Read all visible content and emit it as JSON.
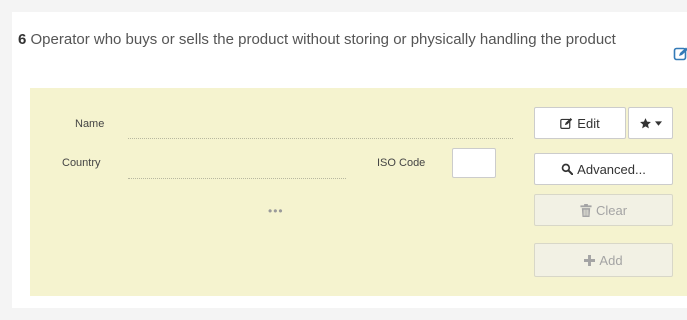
{
  "section": {
    "number": "6",
    "title": "Operator who buys or sells the product without storing or physically handling the product"
  },
  "fields": {
    "name_label": "Name",
    "country_label": "Country",
    "iso_code_label": "ISO Code",
    "more_dots": "•••"
  },
  "buttons": {
    "edit_label": "Edit",
    "advanced_label": "Advanced...",
    "clear_label": "Clear",
    "add_label": "Add"
  },
  "icons": {
    "section_edit": "edit-icon",
    "edit": "pencil-square-icon",
    "favorites": "star-icon",
    "dropdown": "caret-down-icon",
    "advanced": "search-icon",
    "clear": "trash-icon",
    "add": "plus-icon"
  },
  "colors": {
    "form_background": "#f5f3cf",
    "accent_icon": "#337ab7",
    "disabled_text": "#a4a4a4"
  }
}
